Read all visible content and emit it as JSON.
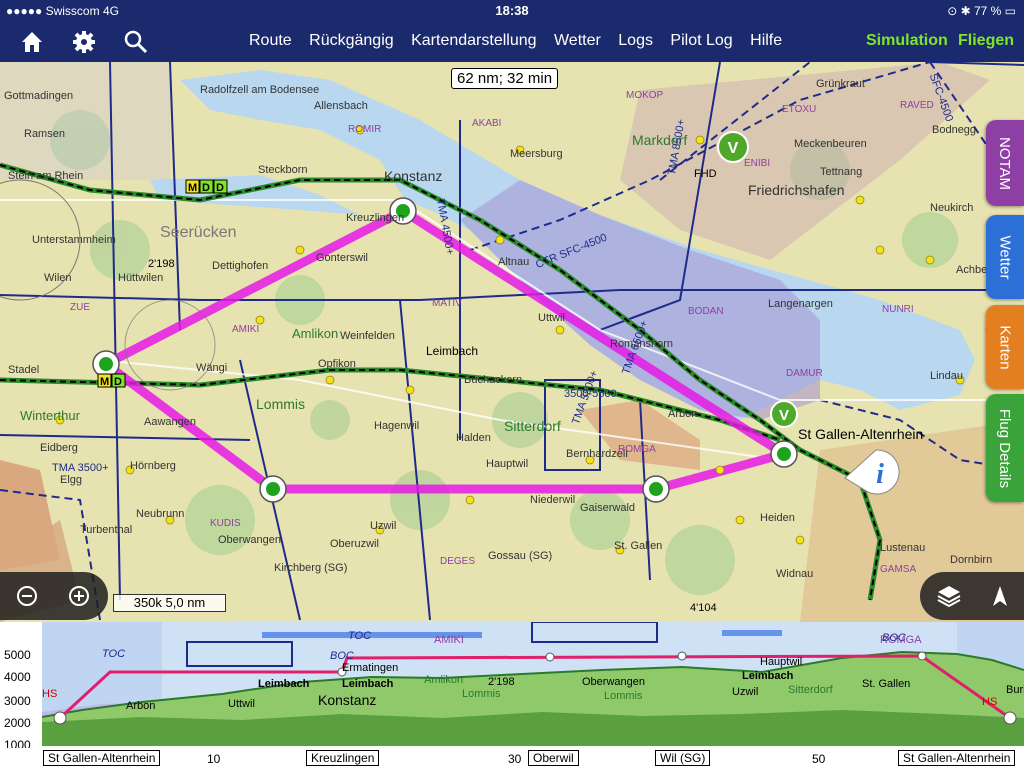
{
  "status": {
    "carrier": "Swisscom",
    "network": "4G",
    "time": "18:38",
    "battery": "77 %"
  },
  "toolbar": {
    "menu": [
      "Route",
      "Rückgängig",
      "Kartendarstellung",
      "Wetter",
      "Logs",
      "Pilot Log",
      "Hilfe"
    ],
    "simulation": "Simulation",
    "fly": "Fliegen"
  },
  "map": {
    "distance_time": "62 nm; 32 min",
    "scale": "350k 5,0 nm",
    "labels": [
      "Konstanz",
      "Kreuzlingen",
      "Friedrichshafen",
      "Markdorf",
      "Meersburg",
      "Tettnang",
      "Steckborn",
      "Stein am Rhein",
      "Unterstammheim",
      "Wilen",
      "Hüttwilen",
      "Dettighofen",
      "Gonterswil",
      "Amlikon",
      "Weinfelden",
      "Opfikon",
      "Leimbach",
      "Buchackern",
      "Uttwil",
      "Romanshorn",
      "Arbon",
      "St Gallen-Altenrhein",
      "Sitterdorf",
      "Hagenwil",
      "Halden",
      "Hauptwil",
      "Bernhardzell",
      "Niederwil",
      "Lommis",
      "Winterthur",
      "Aawangen",
      "Hörnberg",
      "Eidberg",
      "Turbenthal",
      "Neubrunn",
      "Oberwangen",
      "Uzwil",
      "Kirchberg (SG)",
      "Gossau (SG)",
      "St. Gallen",
      "Heiden",
      "Widnau",
      "Lustenau",
      "Dornbirn",
      "Lindau",
      "Langenargen",
      "Neukirch",
      "Achberg",
      "Grünkraut",
      "Bodnegg",
      "Meckenbeuren",
      "Radolfzell am Bodensee",
      "Allensbach",
      "Gottmadingen",
      "Ramsen",
      "Altnau",
      "Stadel",
      "Gaiserwald",
      "Oberuzwil",
      "Wängi",
      "Elgg",
      "Seerücken"
    ],
    "airspace_labels": [
      "CTR SFC-4500",
      "TMA 4500+",
      "TMA 3500+",
      "3500-5500",
      "TMA 5500+",
      "TMA 6500+",
      "TMA 8500+",
      "SFC-4500"
    ],
    "waypoints": [
      "ROMIR",
      "MOKOP",
      "AKABI",
      "ETOXU",
      "RAVED",
      "ENIBI",
      "ZUE",
      "AMIKI",
      "MATIV",
      "BODAN",
      "DAMUR",
      "ROMGA",
      "KUDIS",
      "DEGES",
      "NUNRI",
      "GAMSA"
    ],
    "elevations": [
      "2'198",
      "4'104"
    ],
    "airfield_codes": [
      "FHD",
      "V",
      "V",
      "M",
      "D",
      "D",
      "M",
      "D"
    ],
    "info_marker": "i"
  },
  "side_tabs": [
    "NOTAM",
    "Wetter",
    "Karten",
    "Flug Details"
  ],
  "profile": {
    "altitude_ticks": [
      "5000",
      "4000",
      "3000",
      "2000",
      "1000"
    ],
    "labels": [
      "TOC",
      "BOC",
      "TOC",
      "BOC",
      "AMIKI",
      "ROMGA",
      "Ermatingen",
      "Leimbach",
      "Leimbach",
      "Amlikon",
      "2'198",
      "Oberwangen",
      "Leimbach",
      "Konstanz",
      "Lommis",
      "Lommis",
      "Uttwil",
      "Uzwil",
      "Sitterdorf",
      "St. Gallen",
      "Hauptwil",
      "Arbon",
      "HS",
      "HS",
      "Burie"
    ],
    "distance_ticks": [
      "10",
      "30",
      "50"
    ],
    "places": [
      "St Gallen-Altenrhein",
      "Kreuzlingen",
      "Oberwil",
      "Wil (SG)",
      "St Gallen-Altenrhein"
    ]
  },
  "colors": {
    "route": "#e619e6",
    "bar": "#1a2a6c",
    "accent": "#7fe52a",
    "notam": "#8e44ad",
    "wetter": "#2c6fd6",
    "karten": "#e67e22",
    "flug": "#3aa33a"
  }
}
